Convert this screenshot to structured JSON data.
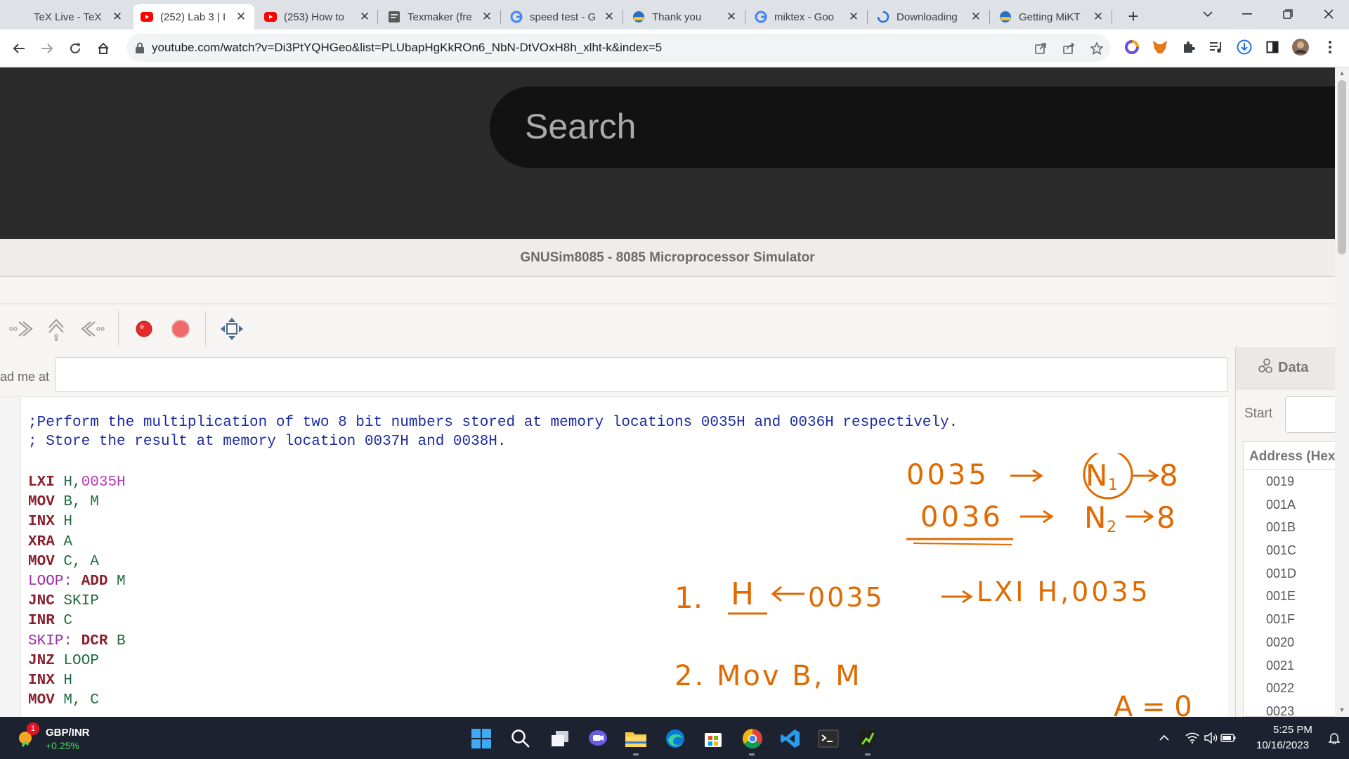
{
  "browser": {
    "tabs": [
      {
        "label": "TeX Live - TeX",
        "icon": "tex-favicon",
        "active": false
      },
      {
        "label": "(252) Lab 3 | I",
        "icon": "youtube-icon",
        "active": true
      },
      {
        "label": "(253) How to",
        "icon": "youtube-icon",
        "active": false
      },
      {
        "label": "Texmaker (fre",
        "icon": "texmaker-icon",
        "active": false
      },
      {
        "label": "speed test - G",
        "icon": "google-icon",
        "active": false
      },
      {
        "label": "Thank you",
        "icon": "miktex-icon",
        "active": false
      },
      {
        "label": "miktex - Goo",
        "icon": "google-icon",
        "active": false
      },
      {
        "label": "Downloading",
        "icon": "loading-icon",
        "active": false
      },
      {
        "label": "Getting MiKT",
        "icon": "miktex-icon",
        "active": false
      }
    ],
    "tab_close_glyph": "✕",
    "new_tab_glyph": "+",
    "url": "youtube.com/watch?v=Di3PtYQHGeo&list=PLUbapHgKkROn6_NbN-DtVOxH8h_xlht-k&index=5"
  },
  "youtube": {
    "search_placeholder": "Search"
  },
  "simulator": {
    "title": "GNUSim8085 - 8085 Microprocessor Simulator",
    "load_label": "ad me at",
    "code_lines": [
      {
        "text": ";Perform the multiplication of two 8 bit numbers stored at memory locations 0035H and 0036H respectively.",
        "cls": "comment"
      },
      {
        "text": "; Store the result at memory location 0037H and 0038H.",
        "cls": "comment"
      }
    ],
    "instructions": [
      {
        "label": "",
        "op": "LXI",
        "args": "H,",
        "imm": "0035H"
      },
      {
        "label": "",
        "op": "MOV",
        "args": "B, M",
        "imm": ""
      },
      {
        "label": "",
        "op": "INX",
        "args": "H",
        "imm": ""
      },
      {
        "label": "",
        "op": "XRA",
        "args": "A",
        "imm": ""
      },
      {
        "label": "",
        "op": "MOV",
        "args": "C, A",
        "imm": ""
      },
      {
        "label": "LOOP:",
        "op": "ADD",
        "args": "M",
        "imm": ""
      },
      {
        "label": "",
        "op": "JNC",
        "args": "SKIP",
        "imm": ""
      },
      {
        "label": "",
        "op": "INR",
        "args": "C",
        "imm": ""
      },
      {
        "label": "SKIP:",
        "op": "DCR",
        "args": "B",
        "imm": ""
      },
      {
        "label": "",
        "op": "JNZ",
        "args": "LOOP",
        "imm": ""
      },
      {
        "label": "",
        "op": "INX",
        "args": "H",
        "imm": ""
      },
      {
        "label": "",
        "op": "MOV",
        "args": "M, C",
        "imm": ""
      }
    ],
    "handwriting": {
      "line1_left": "0035",
      "line1_n": "N",
      "line1_sub": "1",
      "line1_val": "8",
      "line2_left": "0036",
      "line2_n": "N",
      "line2_sub": "2",
      "line2_val": "8",
      "step1_num": "1.",
      "step1_reg": "H",
      "step1_addr": "0035",
      "step1_instr": "LXI H,0035",
      "step2": "2. Mov B, M",
      "note": "A = 0"
    },
    "data_tab_label": "Data",
    "start_label": "Start",
    "address_header": "Address (Hex)",
    "addresses": [
      "0019",
      "001A",
      "001B",
      "001C",
      "001D",
      "001E",
      "001F",
      "0020",
      "0021",
      "0022",
      "0023"
    ]
  },
  "taskbar": {
    "ticker_name": "GBP/INR",
    "ticker_change": "+0.25%",
    "ticker_badge": "1",
    "time": "5:25 PM",
    "date": "10/16/2023"
  },
  "colors": {
    "accent_red": "#ff0000",
    "handwriting": "#e06a00",
    "youtube_header": "#2b2b2b"
  }
}
